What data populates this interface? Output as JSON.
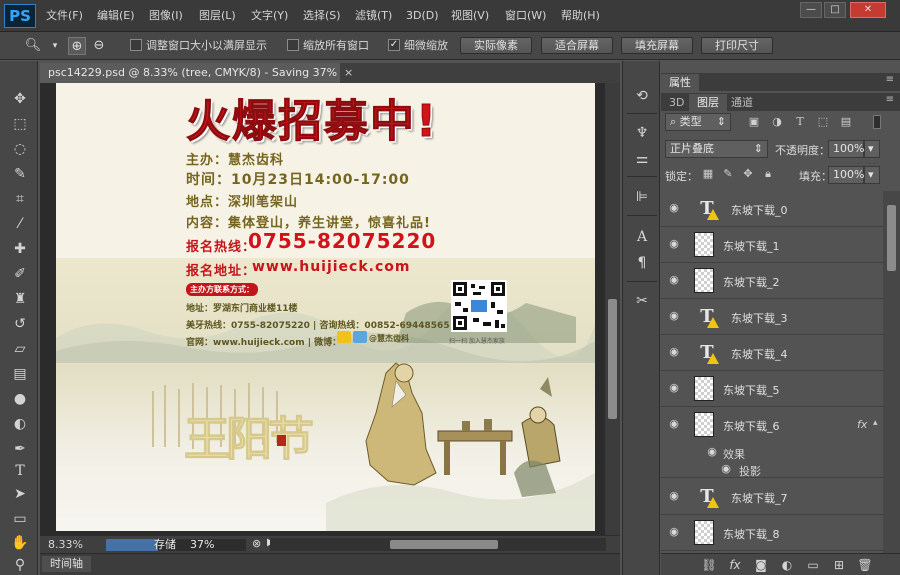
{
  "app": {
    "logo": "PS"
  },
  "menu": [
    {
      "label": "文件(F)"
    },
    {
      "label": "编辑(E)"
    },
    {
      "label": "图像(I)"
    },
    {
      "label": "图层(L)"
    },
    {
      "label": "文字(Y)"
    },
    {
      "label": "选择(S)"
    },
    {
      "label": "滤镜(T)"
    },
    {
      "label": "3D(D)"
    },
    {
      "label": "视图(V)"
    },
    {
      "label": "窗口(W)"
    },
    {
      "label": "帮助(H)"
    }
  ],
  "window_controls": {
    "minimize": "—",
    "maximize": "□",
    "close": "✕"
  },
  "options": {
    "resize_windows_label": "调整窗口大小以满屏显示",
    "zoom_all_windows_label": "缩放所有窗口",
    "scrubby_zoom_label": "细微缩放",
    "scrubby_zoom_checked": "✓",
    "actual_pixels": "实际像素",
    "fit_screen": "适合屏幕",
    "fill_screen": "填充屏幕",
    "print_size": "打印尺寸"
  },
  "document": {
    "tab_title": "psc14229.psd @ 8.33% (tree, CMYK/8) - Saving 37%",
    "tab_close": "×"
  },
  "poster": {
    "title": "火爆招募中!",
    "organizer": "主办：慧杰齿科",
    "time": "时间：10月23日14:00-17:00",
    "place": "地点：深圳笔架山",
    "content": "内容：集体登山，养生讲堂，惊喜礼品!",
    "hotline_label": "报名热线：",
    "hotline_number": "0755-82075220",
    "website_label": "报名地址：",
    "website_value": "www.huijieck.com",
    "organizer_contact_badge": "主办方联系方式：",
    "address_line": "地址：罗湖东门商业楼11楼",
    "phone_line": "美牙热线：0755-82075220 | 咨询热线：00852-69448565",
    "web_line": "官网：www.huijieck.com | 微博：",
    "weibo_name": "@慧杰齿科",
    "qr_caption": "扫一扫   加入慧杰家族",
    "brush_text": "王阳节"
  },
  "status": {
    "zoom": "8.33%",
    "saving_label": "存储",
    "saving_percent": "37%",
    "progress_fraction": 0.37
  },
  "timeline": {
    "tab_label": "时间轴"
  },
  "panels": {
    "properties_tab": "属性",
    "tab_3d": "3D",
    "tab_layers": "图层",
    "tab_channels": "通道",
    "filter_type": "类型",
    "blend_mode": "正片叠底",
    "opacity_label": "不透明度：",
    "opacity_value": "100%",
    "lock_label": "锁定：",
    "fill_label": "填充：",
    "fill_value": "100%"
  },
  "layers": [
    {
      "name": "东坡下载_0",
      "kind": "text"
    },
    {
      "name": "东坡下载_1",
      "kind": "image"
    },
    {
      "name": "东坡下载_2",
      "kind": "image"
    },
    {
      "name": "东坡下载_3",
      "kind": "text"
    },
    {
      "name": "东坡下载_4",
      "kind": "text"
    },
    {
      "name": "东坡下载_5",
      "kind": "image"
    },
    {
      "name": "东坡下载_6",
      "kind": "image",
      "fx": "fx"
    },
    {
      "name": "东坡下载_7",
      "kind": "text"
    },
    {
      "name": "东坡下载_8",
      "kind": "image"
    }
  ],
  "layer_effects": {
    "effects_label": "效果",
    "shadow_label": "投影"
  },
  "colors": {
    "accent_blue": "#31a8ff",
    "warning": "#f1c40f",
    "poster_red": "#d21418",
    "close_red": "#c43b31"
  }
}
